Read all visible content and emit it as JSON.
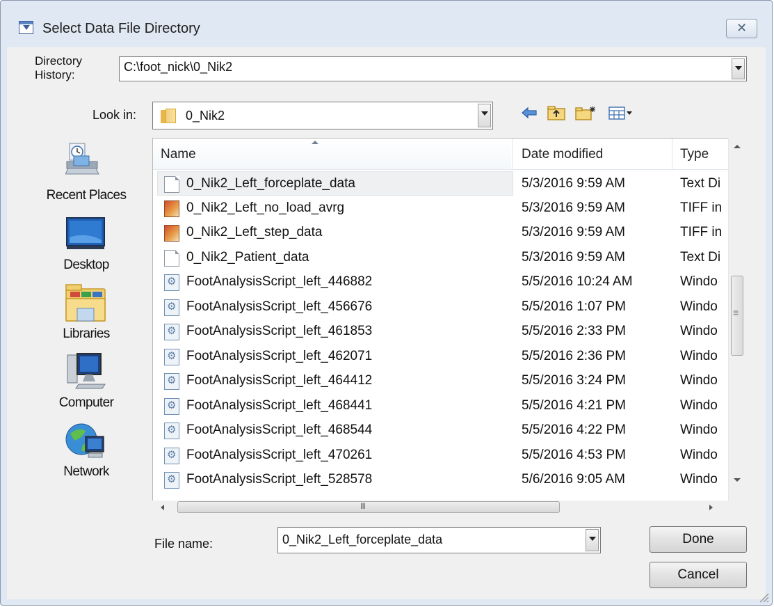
{
  "window": {
    "title": "Select Data File Directory",
    "close_glyph": "✕"
  },
  "directory_history": {
    "label_line1": "Directory",
    "label_line2": "History:",
    "value": "C:\\foot_nick\\0_Nik2"
  },
  "look_in": {
    "label": "Look in:",
    "value": "0_Nik2",
    "icons": [
      "back-arrow-icon",
      "up-folder-icon",
      "new-folder-icon",
      "view-menu-icon"
    ]
  },
  "places": [
    {
      "label": "Recent Places",
      "icon": "recent-places-icon"
    },
    {
      "label": "Desktop",
      "icon": "desktop-icon"
    },
    {
      "label": "Libraries",
      "icon": "libraries-icon"
    },
    {
      "label": "Computer",
      "icon": "computer-icon"
    },
    {
      "label": "Network",
      "icon": "network-icon"
    }
  ],
  "columns": {
    "name": "Name",
    "date": "Date modified",
    "type": "Type"
  },
  "files": [
    {
      "name": "0_Nik2_Left_forceplate_data",
      "date": "5/3/2016 9:59 AM",
      "type": "Text Di",
      "icon": "text"
    },
    {
      "name": "0_Nik2_Left_no_load_avrg",
      "date": "5/3/2016 9:59 AM",
      "type": "TIFF in",
      "icon": "tiff"
    },
    {
      "name": "0_Nik2_Left_step_data",
      "date": "5/3/2016 9:59 AM",
      "type": "TIFF in",
      "icon": "tiff"
    },
    {
      "name": "0_Nik2_Patient_data",
      "date": "5/3/2016 9:59 AM",
      "type": "Text Di",
      "icon": "text"
    },
    {
      "name": "FootAnalysisScript_left_446882",
      "date": "5/5/2016 10:24 AM",
      "type": "Windo",
      "icon": "script"
    },
    {
      "name": "FootAnalysisScript_left_456676",
      "date": "5/5/2016 1:07 PM",
      "type": "Windo",
      "icon": "script"
    },
    {
      "name": "FootAnalysisScript_left_461853",
      "date": "5/5/2016 2:33 PM",
      "type": "Windo",
      "icon": "script"
    },
    {
      "name": "FootAnalysisScript_left_462071",
      "date": "5/5/2016 2:36 PM",
      "type": "Windo",
      "icon": "script"
    },
    {
      "name": "FootAnalysisScript_left_464412",
      "date": "5/5/2016 3:24 PM",
      "type": "Windo",
      "icon": "script"
    },
    {
      "name": "FootAnalysisScript_left_468441",
      "date": "5/5/2016 4:21 PM",
      "type": "Windo",
      "icon": "script"
    },
    {
      "name": "FootAnalysisScript_left_468544",
      "date": "5/5/2016 4:22 PM",
      "type": "Windo",
      "icon": "script"
    },
    {
      "name": "FootAnalysisScript_left_470261",
      "date": "5/5/2016 4:53 PM",
      "type": "Windo",
      "icon": "script"
    },
    {
      "name": "FootAnalysisScript_left_528578",
      "date": "5/6/2016 9:05 AM",
      "type": "Windo",
      "icon": "script"
    }
  ],
  "scroll": {
    "hscroll_thumb_glyph": "III",
    "vscroll_thumb_glyph": "≡"
  },
  "file_name": {
    "label": "File name:",
    "value": "0_Nik2_Left_forceplate_data"
  },
  "buttons": {
    "done": "Done",
    "cancel": "Cancel"
  }
}
